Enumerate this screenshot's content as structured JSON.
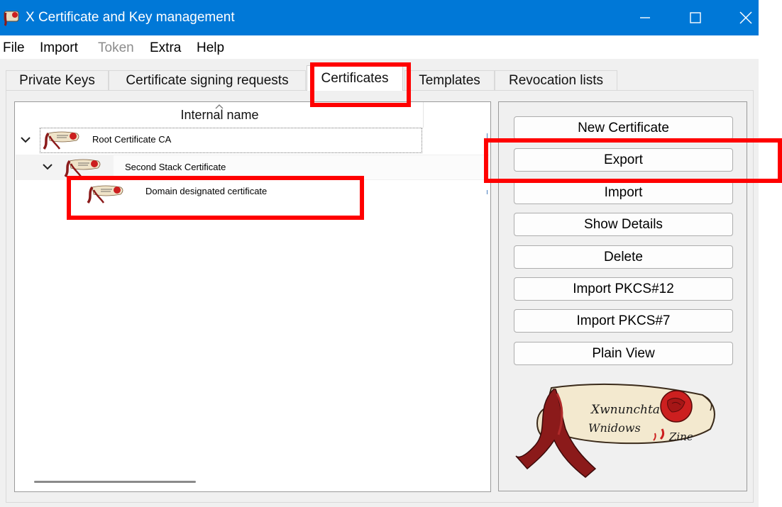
{
  "window": {
    "title": "X Certificate and Key management",
    "controls": [
      "minimize-icon",
      "maximize-icon",
      "close-icon"
    ]
  },
  "menu": [
    {
      "label": "File",
      "disabled": false
    },
    {
      "label": "Import",
      "disabled": false
    },
    {
      "label": "Token",
      "disabled": true
    },
    {
      "label": "Extra",
      "disabled": false
    },
    {
      "label": "Help",
      "disabled": false
    }
  ],
  "tabs": [
    {
      "label": "Private Keys",
      "active": false
    },
    {
      "label": "Certificate signing requests",
      "active": false
    },
    {
      "label": "Certificates",
      "active": true
    },
    {
      "label": "Templates",
      "active": false
    },
    {
      "label": "Revocation lists",
      "active": false
    }
  ],
  "tree": {
    "column_header": "Internal name",
    "rows": [
      {
        "label": "Root Certificate CA",
        "level": 0,
        "expanded": true,
        "icon": "certificate-scroll-icon"
      },
      {
        "label": "Second Stack Certificate",
        "level": 1,
        "expanded": true,
        "icon": "certificate-scroll-icon"
      },
      {
        "label": "Domain designated certificate",
        "level": 2,
        "icon": "certificate-scroll-icon"
      }
    ]
  },
  "buttons": [
    {
      "label": "New Certificate"
    },
    {
      "label": "Export"
    },
    {
      "label": "Import"
    },
    {
      "label": "Show Details"
    },
    {
      "label": "Delete"
    },
    {
      "label": "Import PKCS#12"
    },
    {
      "label": "Import PKCS#7"
    },
    {
      "label": "Plain View"
    }
  ],
  "logo": {
    "icon": "certificate-scroll-logo",
    "text_line1": "Xwnunchta",
    "text_line2": "Wnidows",
    "text_line3": "Zine"
  },
  "colors": {
    "titlebar": "#0078d7",
    "highlight": "#ff0000",
    "scroll_ribbon": "#8b1a1a",
    "seal": "#cc1f1f"
  }
}
